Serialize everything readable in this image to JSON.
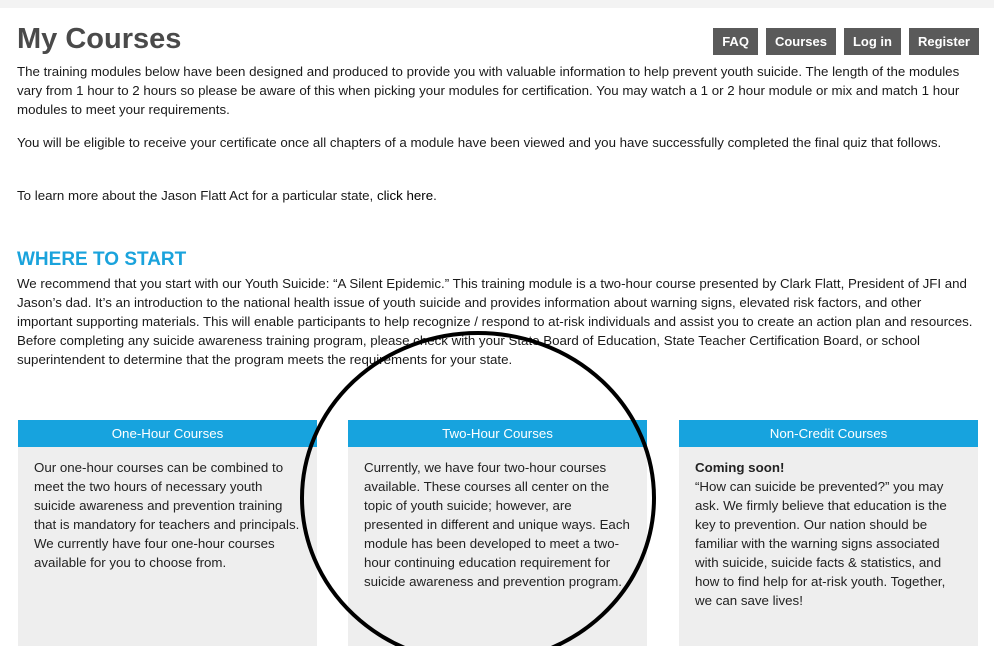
{
  "page": {
    "title": "My Courses",
    "nav": [
      "FAQ",
      "Courses",
      "Log in",
      "Register"
    ],
    "intro": [
      "The training modules below have been designed and produced to provide you with valuable information to help prevent youth suicide. The length of the modules vary from 1 hour to 2 hours so please be aware of this when picking your modules for certification. You may watch a 1 or 2 hour module or mix and match 1 hour modules to meet your requirements.",
      "You will be eligible to receive your certificate once all chapters of a module have been viewed and you have successfully completed the final quiz that follows."
    ],
    "learn_more": {
      "prefix": "To learn more about the Jason Flatt Act for a particular state, ",
      "link": "click here",
      "suffix": "."
    }
  },
  "where_to_start": {
    "heading": "WHERE TO START",
    "text": "We recommend that you start with our Youth Suicide: “A Silent Epidemic.” This training module is a two-hour course presented by Clark Flatt, President of JFI and Jason’s dad. It’s an introduction to the national health issue of youth suicide and provides information about warning signs, elevated risk factors, and other important supporting materials. This will enable participants to help recognize / respond to at-risk individuals and assist you to create an action plan and resources. Before completing any suicide awareness training program, please check with your State Board of Education, State Teacher Certification Board, or school superintendent to determine that the program meets the requirements for your state."
  },
  "cards": [
    {
      "title": "One-Hour Courses",
      "strong": "",
      "body": "Our one-hour courses can be combined to meet the two hours of necessary youth suicide awareness and prevention training that is mandatory for teachers and principals. We currently have four one-hour courses available for you to choose from."
    },
    {
      "title": "Two-Hour Courses",
      "strong": "",
      "body": "Currently, we have four two-hour courses available. These courses all center on the topic of youth suicide; however, are presented in different and unique ways. Each module has been developed to meet a two-hour continuing education requirement for suicide awareness and prevention program."
    },
    {
      "title": "Non-Credit Courses",
      "strong": "Coming soon!",
      "body": "“How can suicide be prevented?” you may ask. We firmly believe that education is the key to prevention. Our nation should be familiar with the warning signs associated with suicide, suicide facts & statistics, and how to find help for at-risk youth. Together, we can save lives!"
    }
  ],
  "colors": {
    "accent": "#17a3de",
    "heading": "#1aa3dc",
    "nav_button": "#5a5a5a",
    "card_bg": "#eeeeee",
    "annotation": "#000000"
  }
}
